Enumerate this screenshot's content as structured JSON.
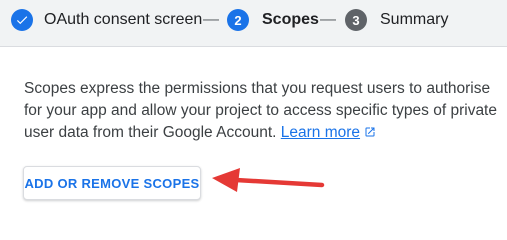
{
  "stepper": {
    "steps": [
      {
        "number": "",
        "label": "OAuth consent screen",
        "state": "done",
        "icon": "check-icon"
      },
      {
        "number": "2",
        "label": "Scopes",
        "state": "current"
      },
      {
        "number": "3",
        "label": "Summary",
        "state": "upcoming"
      }
    ],
    "separator": "—"
  },
  "description": {
    "text": "Scopes express the permissions that you request users to authorise for your app and allow your project to access specific types of private user data from their Google Account.",
    "link_label": "Learn more",
    "link_icon": "open-in-new-icon"
  },
  "add_scopes_button": {
    "label": "ADD OR REMOVE SCOPES"
  },
  "annotation": {
    "icon": "red-arrow",
    "color": "#e53935"
  },
  "colors": {
    "accent": "#1a73e8",
    "upcoming": "#5f6368",
    "annotation": "#e53935"
  }
}
